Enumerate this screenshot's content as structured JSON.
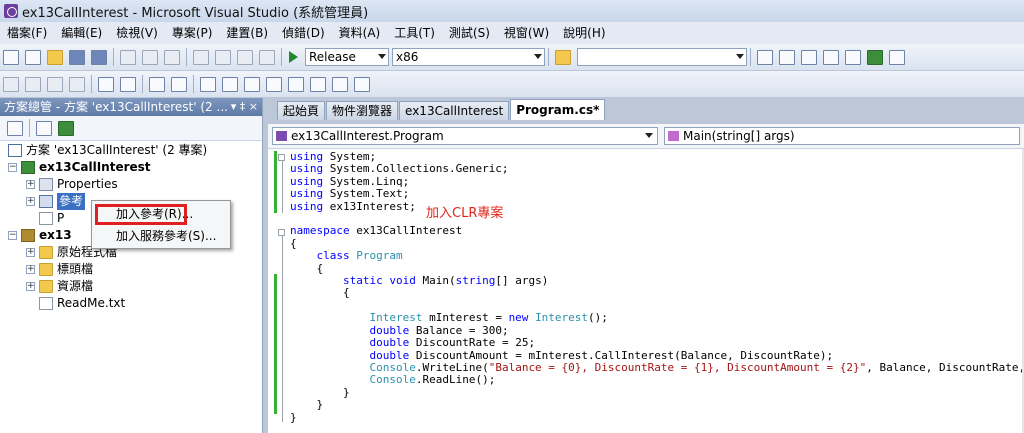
{
  "window": {
    "title": "ex13CallInterest - Microsoft Visual Studio (系統管理員)"
  },
  "menu": [
    "檔案(F)",
    "編輯(E)",
    "檢視(V)",
    "專案(P)",
    "建置(B)",
    "偵錯(D)",
    "資料(A)",
    "工具(T)",
    "測試(S)",
    "視窗(W)",
    "說明(H)"
  ],
  "toolbar": {
    "config": "Release",
    "platform": "x86",
    "find": ""
  },
  "solution_explorer": {
    "title": "方案總管 - 方案 'ex13CallInterest' (2 ...",
    "pin": "▾ ‡ ×",
    "items": {
      "solution": "方案 'ex13CallInterest' (2 專案)",
      "project1": "ex13CallInterest",
      "properties": "Properties",
      "references": "參考",
      "program_file": "P",
      "project2": "ex13",
      "folder_source": "原始程式檔",
      "folder_header": "標頭檔",
      "folder_resource": "資源檔",
      "readme": "ReadMe.txt"
    }
  },
  "context_menu": {
    "add_reference": "加入參考(R)...",
    "add_service_reference": "加入服務參考(S)..."
  },
  "tabs": [
    "起始頁",
    "物件瀏覽器",
    "ex13CallInterest",
    "Program.cs*"
  ],
  "nav": {
    "class": "ex13CallInterest.Program",
    "member": "Main(string[] args)"
  },
  "annotation": "加入CLR專案",
  "code": {
    "l1_kw": "using",
    "l1_rest": " System;",
    "l2_kw": "using",
    "l2_rest": " System.Collections.Generic;",
    "l3_kw": "using",
    "l3_rest": " System.Linq;",
    "l4_kw": "using",
    "l4_rest": " System.Text;",
    "l5_kw": "using",
    "l5_rest": " ex13Interest;",
    "ns_kw": "namespace",
    "ns_rest": " ex13CallInterest",
    "brace_open": "{",
    "brace_close": "}",
    "cls_kw": "class",
    "cls_name": "Program",
    "main_kw1": "static",
    "main_kw2": "void",
    "main_name": " Main(",
    "main_kw3": "string",
    "main_rest": "[] args)",
    "l_new_ty": "Interest",
    "l_new_mid": " mInterest = ",
    "l_new_kw": "new",
    "l_new_ty2": "Interest",
    "l_new_end": "();",
    "d1_kw": "double",
    "d1_rest": " Balance = 300;",
    "d2_kw": "double",
    "d2_rest": " DiscountRate = 25;",
    "d3_kw": "double",
    "d3_rest": " DiscountAmount = mInterest.CallInterest(Balance, DiscountRate);",
    "wl_ty": "Console",
    "wl_mid": ".WriteLine(",
    "wl_str": "\"Balance = {0}, DiscountRate = {1}, DiscountAmount = {2}\"",
    "wl_end": ", Balance, DiscountRate, DiscountAmount);",
    "rl_ty": "Console",
    "rl_rest": ".ReadLine();"
  }
}
